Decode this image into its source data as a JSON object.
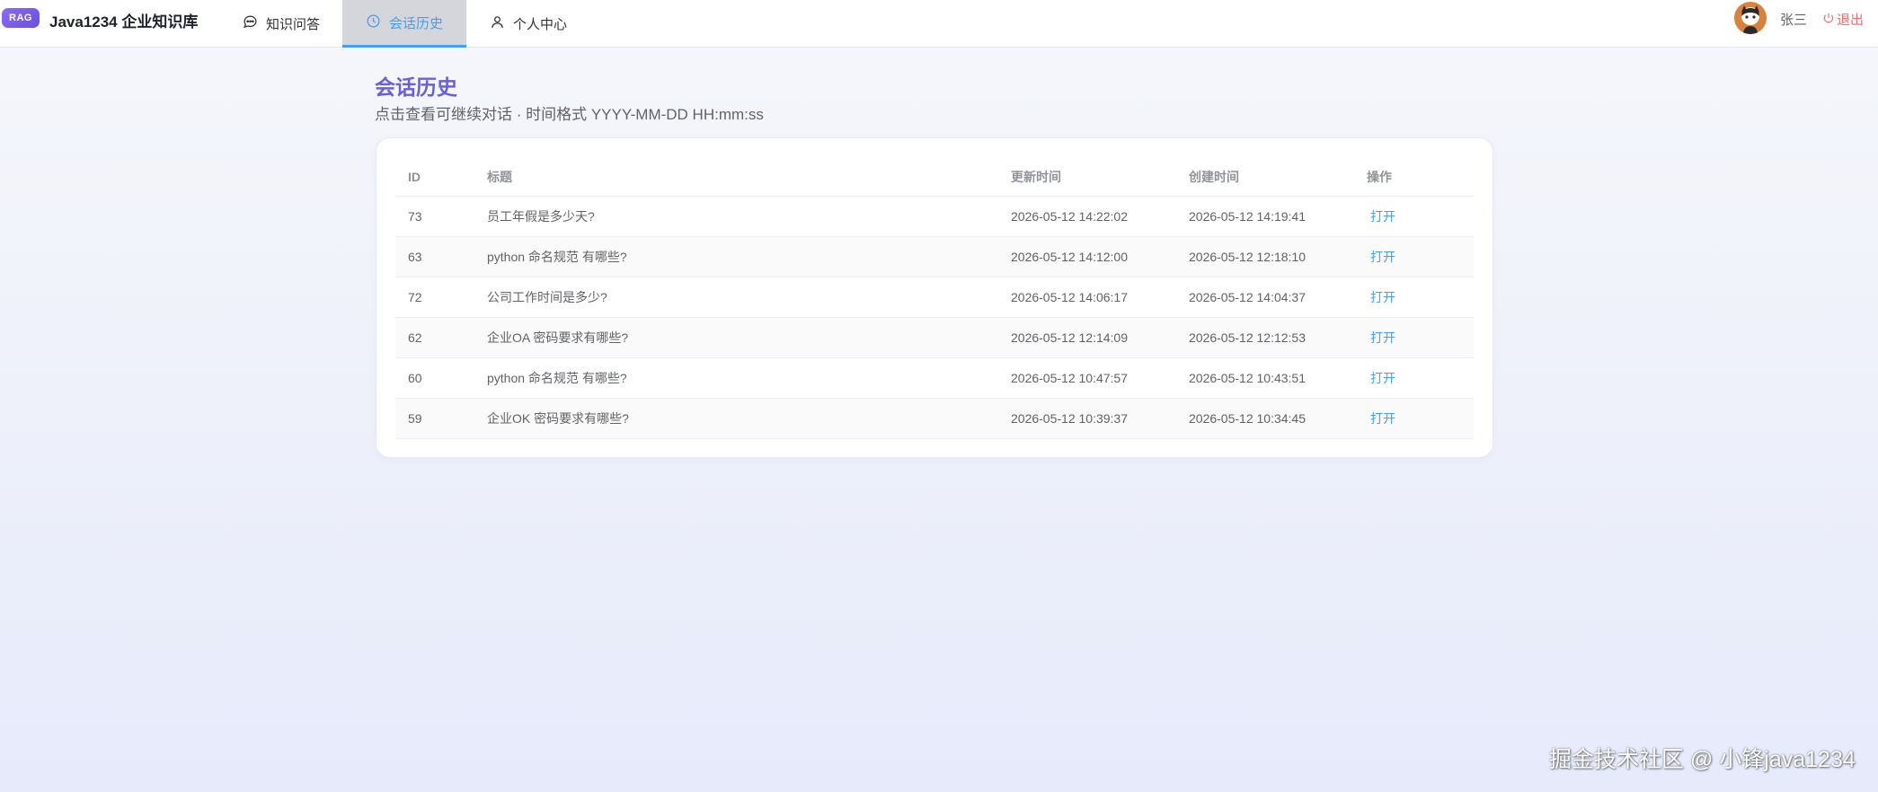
{
  "header": {
    "logo_badge": "RAG",
    "app_title": "Java1234 企业知识库",
    "nav": [
      {
        "label": "知识问答",
        "icon": "chat-bubble-icon"
      },
      {
        "label": "会话历史",
        "icon": "clock-icon"
      },
      {
        "label": "个人中心",
        "icon": "user-icon"
      }
    ],
    "user_name": "张三",
    "logout_label": "退出",
    "accent_color": "#409eff"
  },
  "page": {
    "title": "会话历史",
    "subtitle": "点击查看可继续对话 · 时间格式 YYYY-MM-DD HH:mm:ss"
  },
  "table": {
    "columns": [
      "ID",
      "标题",
      "更新时间",
      "创建时间",
      "操作"
    ],
    "rows": [
      {
        "id": "73",
        "title": "员工年假是多少天?",
        "updated": "2026-05-12 14:22:02",
        "created": "2026-05-12 14:19:41",
        "action": "打开"
      },
      {
        "id": "63",
        "title": "python 命名规范 有哪些?",
        "updated": "2026-05-12 14:12:00",
        "created": "2026-05-12 12:18:10",
        "action": "打开"
      },
      {
        "id": "72",
        "title": "公司工作时间是多少?",
        "updated": "2026-05-12 14:06:17",
        "created": "2026-05-12 14:04:37",
        "action": "打开"
      },
      {
        "id": "62",
        "title": "企业OA 密码要求有哪些?",
        "updated": "2026-05-12 12:14:09",
        "created": "2026-05-12 12:12:53",
        "action": "打开"
      },
      {
        "id": "60",
        "title": "python 命名规范 有哪些?",
        "updated": "2026-05-12 10:47:57",
        "created": "2026-05-12 10:43:51",
        "action": "打开"
      },
      {
        "id": "59",
        "title": "企业OK 密码要求有哪些?",
        "updated": "2026-05-12 10:39:37",
        "created": "2026-05-12 10:34:45",
        "action": "打开"
      }
    ]
  },
  "watermark": "掘金技术社区 @ 小锋java1234"
}
